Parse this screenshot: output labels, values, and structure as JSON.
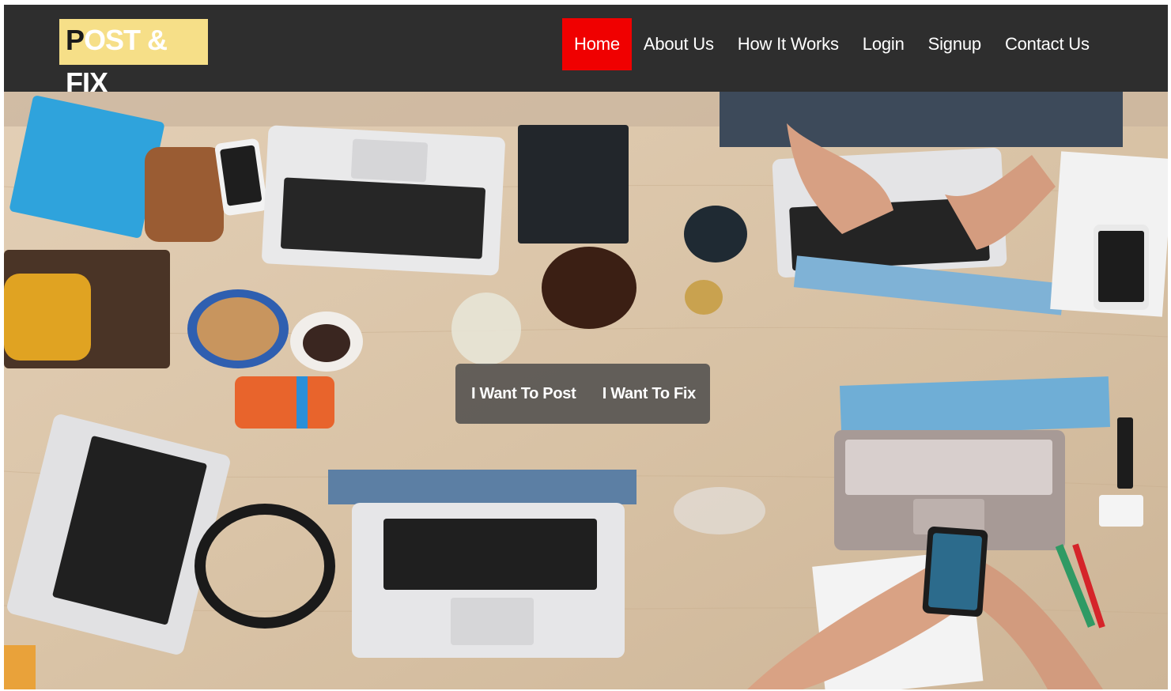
{
  "brand": {
    "logo_first": "P",
    "logo_rest": "OST & FIX",
    "colors": {
      "nav_bg": "#2e2e2e",
      "logo_bg": "#f6df88",
      "active": "#f00000"
    }
  },
  "nav": {
    "items": [
      {
        "label": "Home",
        "active": true
      },
      {
        "label": "About Us"
      },
      {
        "label": "How It Works"
      },
      {
        "label": "Login"
      },
      {
        "label": "Signup"
      },
      {
        "label": "Contact Us"
      }
    ]
  },
  "hero": {
    "cta_post": "I Want To Post",
    "cta_fix": "I Want To Fix"
  }
}
